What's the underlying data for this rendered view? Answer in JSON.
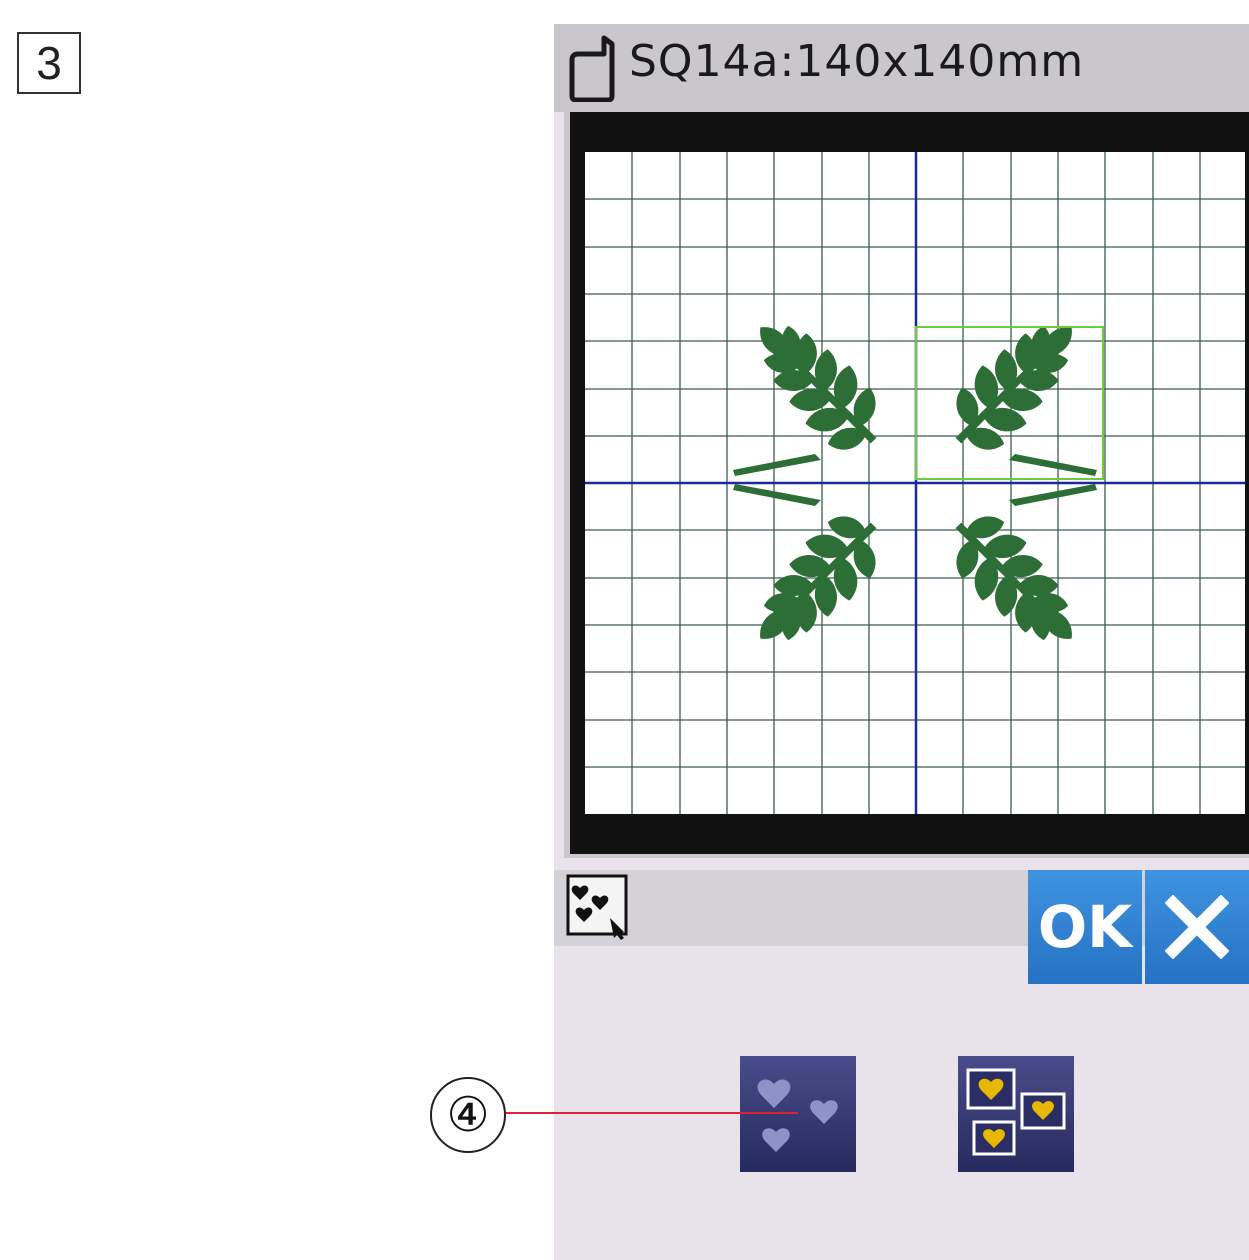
{
  "step_number": "3",
  "screen": {
    "title": "SQ14a:140x140mm",
    "icons": {
      "hoop": "hoop-icon",
      "group_select": "multi-heart-select-icon",
      "select_all": "select-all-hearts-icon",
      "select_each": "select-each-hearts-icon",
      "cancel": "close-icon"
    },
    "ok_label": "OK"
  },
  "callout": {
    "label": "④"
  },
  "colors": {
    "button_blue": "#2f80d2",
    "design_green": "#2d6e37",
    "grid_line": "#3c5a50",
    "center_axis": "#1a2c9c",
    "selection_box": "#6ccc3c",
    "heart_selected": "#e8b800",
    "heart_unselected": "#8f92c6",
    "callout_line": "#e0203a"
  }
}
